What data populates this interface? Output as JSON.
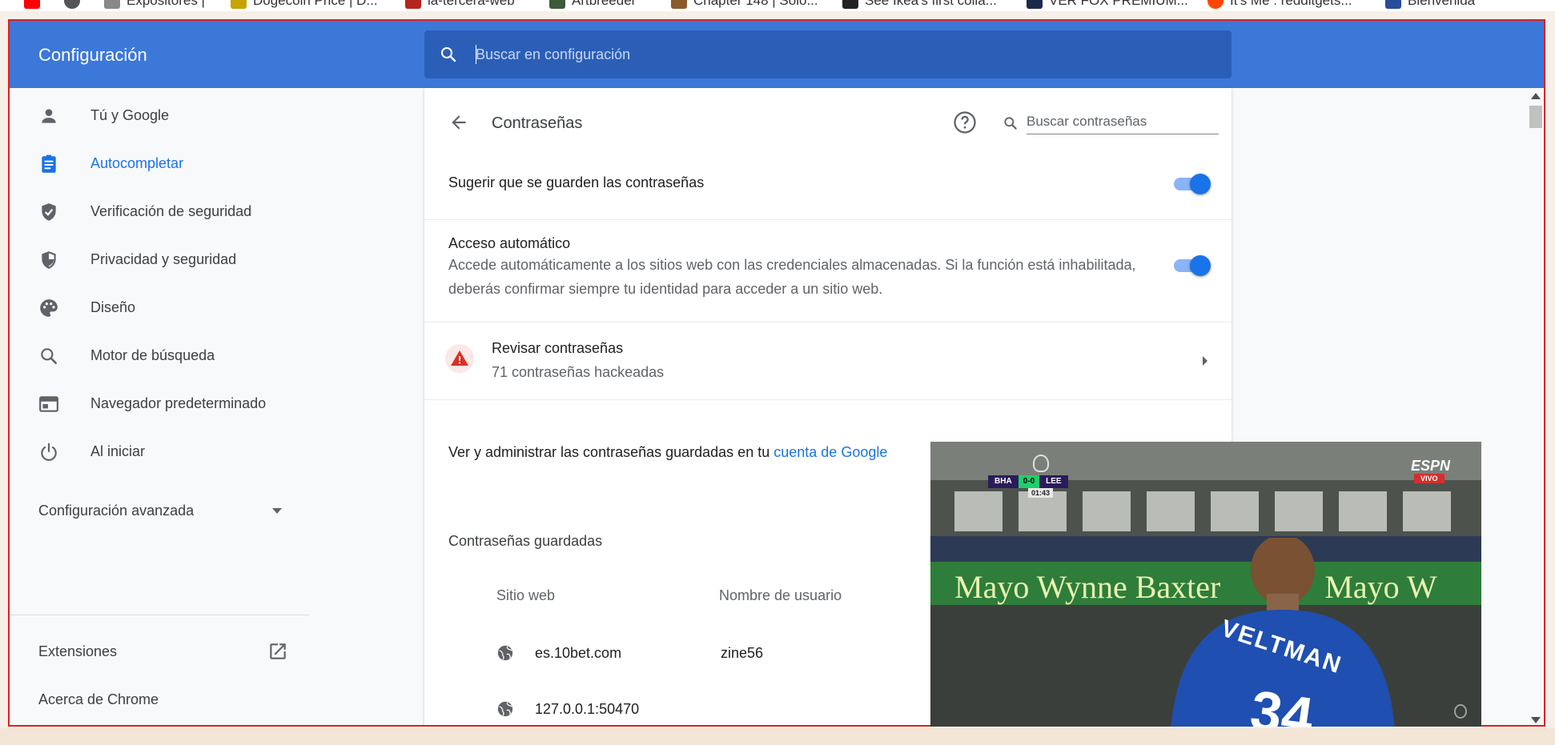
{
  "bookmarks": [
    {
      "label": "Expositores |",
      "color": "#888888"
    },
    {
      "label": "Dogecoin Price | D...",
      "color": "#c8a200"
    },
    {
      "label": "la-tercera-web",
      "color": "#b3261e"
    },
    {
      "label": "Artbreeder",
      "color": "#3d5a3a"
    },
    {
      "label": "Chapter 148 | Solo...",
      "color": "#8a5a2b"
    },
    {
      "label": "See Ikea's first colla...",
      "color": "#222222"
    },
    {
      "label": "VER FOX PREMIUM...",
      "color": "#1c2a4a"
    },
    {
      "label": "It's Me : redditgets...",
      "color": "#ff4500"
    },
    {
      "label": "Bienvenida",
      "color": "#2a4b9b"
    }
  ],
  "header": {
    "title": "Configuración",
    "search_placeholder": "Buscar en configuración"
  },
  "sidebar": {
    "items": [
      {
        "label": "Tú y Google",
        "icon": "person-icon",
        "active": false
      },
      {
        "label": "Autocompletar",
        "icon": "clipboard-icon",
        "active": true
      },
      {
        "label": "Verificación de seguridad",
        "icon": "shield-check-icon",
        "active": false
      },
      {
        "label": "Privacidad y seguridad",
        "icon": "shield-half-icon",
        "active": false
      },
      {
        "label": "Diseño",
        "icon": "palette-icon",
        "active": false
      },
      {
        "label": "Motor de búsqueda",
        "icon": "search-icon",
        "active": false
      },
      {
        "label": "Navegador predeterminado",
        "icon": "browser-window-icon",
        "active": false
      },
      {
        "label": "Al iniciar",
        "icon": "power-icon",
        "active": false
      }
    ],
    "advanced_label": "Configuración avanzada",
    "extensions_label": "Extensiones",
    "about_label": "Acerca de Chrome"
  },
  "passwords": {
    "title": "Contraseñas",
    "search_placeholder": "Buscar contraseñas",
    "offer_to_save": {
      "label": "Sugerir que se guarden las contraseñas",
      "enabled": true
    },
    "auto_signin": {
      "label": "Acceso automático",
      "description": "Accede automáticamente a los sitios web con las credenciales almacenadas. Si la función está inhabilitada, deberás confirmar siempre tu identidad para acceder a un sitio web.",
      "enabled": true
    },
    "check": {
      "label": "Revisar contraseñas",
      "sublabel": "71 contraseñas hackeadas"
    },
    "manage_text": "Ver y administrar las contraseñas guardadas en tu",
    "manage_link": "cuenta de Google",
    "saved_heading": "Contraseñas guardadas",
    "columns": {
      "site": "Sitio web",
      "username": "Nombre de usuario"
    },
    "rows": [
      {
        "site": "es.10bet.com",
        "username": "zine56"
      },
      {
        "site": "127.0.0.1:50470",
        "username": ""
      }
    ]
  },
  "video": {
    "score_home": "BHA",
    "score": "0-0",
    "score_away": "LEE",
    "clock": "01:43",
    "broadcaster": "ESPN",
    "live_badge": "VIVO",
    "banner_text": "Mayo Wynne Baxter",
    "banner_text_2": "Mayo W",
    "player_name": "VELTMAN",
    "player_number": "34"
  },
  "colors": {
    "header_blue": "#3c78d8",
    "accent": "#1a73e8",
    "window_border": "#e02020"
  }
}
